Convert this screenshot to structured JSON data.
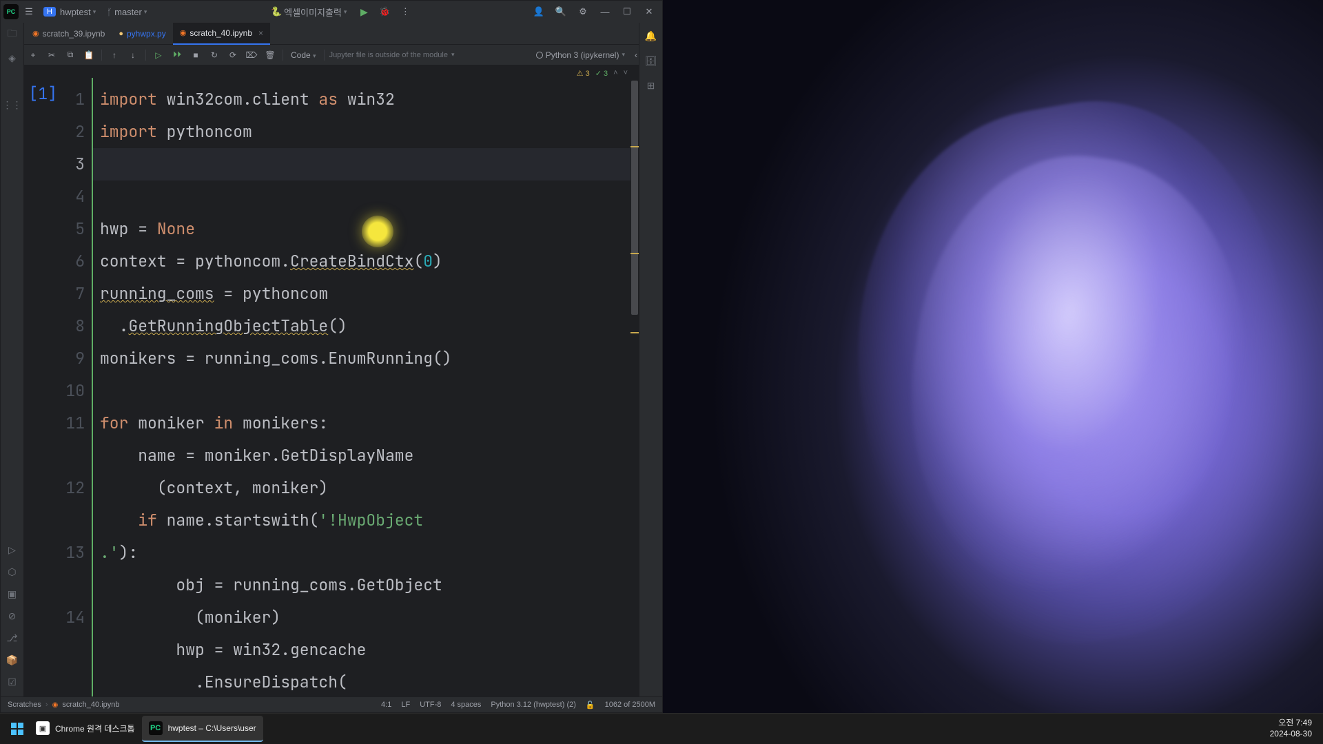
{
  "titlebar": {
    "pycharm_badge": "PC",
    "project_badge": "H",
    "project_name": "hwptest",
    "branch_name": "master",
    "run_config": "엑셀이미지출력"
  },
  "tabs": [
    {
      "name": "scratch_39.ipynb",
      "icon": "jupyter",
      "active": false,
      "modified": false
    },
    {
      "name": "pyhwpx.py",
      "icon": "python",
      "active": false,
      "modified": true
    },
    {
      "name": "scratch_40.ipynb",
      "icon": "jupyter",
      "active": true,
      "modified": false
    }
  ],
  "toolbar": {
    "cell_type": "Code",
    "jupyter_msg": "Jupyter file is outside of the module",
    "kernel": "Python 3 (ipykernel)"
  },
  "inspections": {
    "warnings": "3",
    "typos": "3"
  },
  "cell_indicator": "[1]",
  "line_numbers": [
    "1",
    "2",
    "3",
    "4",
    "5",
    "6",
    "7",
    "8",
    "9",
    "10",
    "11",
    "",
    "12",
    "",
    "13",
    "",
    "14",
    ""
  ],
  "current_line_idx": 2,
  "code": {
    "l1_kw1": "import",
    "l1_mod": " win32com.client ",
    "l1_kw2": "as",
    "l1_alias": " win32",
    "l2_kw": "import",
    "l2_mod": " pythoncom",
    "l5_var": "hwp = ",
    "l5_none": "None",
    "l6_a": "context = pythoncom.",
    "l6_fn": "CreateBindCtx",
    "l6_p1": "(",
    "l6_num": "0",
    "l6_p2": ")",
    "l7_a": "running_coms",
    "l7_b": " = pythoncom",
    "l7c_a": "  .",
    "l7c_fn": "GetRunningObjectTable",
    "l7c_p": "()",
    "l8": "monikers = running_coms.EnumRunning()",
    "l10_kw1": "for",
    "l10_a": " moniker ",
    "l10_kw2": "in",
    "l10_b": " monikers:",
    "l11_a": "    name = moniker.GetDisplayName",
    "l11b": "      (context, moniker)",
    "l12_a": "    ",
    "l12_kw": "if",
    "l12_b": " name.startswith(",
    "l12_str": "'!HwpObject",
    "l12b_str": ".'",
    "l12b_p": "):",
    "l13_a": "        obj = running_coms.GetObject",
    "l13b": "          (moniker)",
    "l14_a": "        hwp = win32.gencache",
    "l14b": "          .EnsureDispatch("
  },
  "statusbar": {
    "breadcrumb_root": "Scratches",
    "breadcrumb_file": "scratch_40.ipynb",
    "position": "4:1",
    "line_ending": "LF",
    "encoding": "UTF-8",
    "indent": "4 spaces",
    "interpreter": "Python 3.12 (hwptest) (2)",
    "memory": "1062 of 2500M"
  },
  "taskbar": {
    "chrome_remote": "Chrome 원격 데스크톱",
    "pycharm_task": "hwptest – C:\\Users\\user",
    "time": "오전 7:49",
    "date": "2024-08-30"
  }
}
